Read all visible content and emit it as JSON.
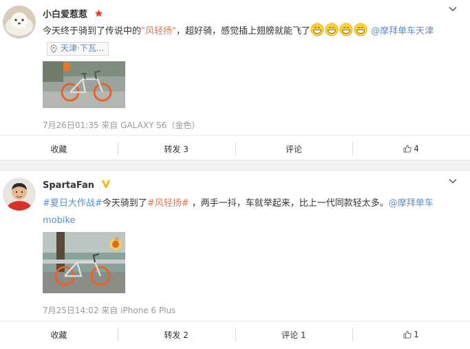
{
  "posts": [
    {
      "user": "小白爱惹惹",
      "text_a": "今天终于骑到了传说中的",
      "text_link": "\"风轻扬\"",
      "text_b": "，超好骑，感觉插上翅膀就能飞了",
      "mention": "@摩拜单车天津",
      "location": "天津·下瓦...",
      "meta": "7月26日01:35 来自 GALAXY S6（金色）",
      "actions": {
        "favorite": "收藏",
        "repost": "转发 3",
        "comment": "评论",
        "like": "4"
      }
    },
    {
      "user": "SpartaFan",
      "topic1": "#夏日大作战#",
      "text_a": "今天骑到了",
      "topic2": "#风轻扬#",
      "text_b": " ，两手一抖，车就举起来，比上一代同款轻太多。",
      "mention": "@摩拜单车mobike",
      "meta": "7月25日14:02 来自 iPhone 6 Plus",
      "actions": {
        "favorite": "收藏",
        "repost": "转发 2",
        "comment": "评论 1",
        "like": "1"
      }
    }
  ],
  "colors": {
    "link": "#eb7350",
    "mention": "#5d8fc9",
    "meta": "#999999",
    "background": "#f2f2f5"
  },
  "icons": [
    "chevron-down-icon",
    "star-badge-icon",
    "vip-badge-icon",
    "grin-emoji-icon",
    "location-pin-icon",
    "thumbs-up-icon"
  ]
}
